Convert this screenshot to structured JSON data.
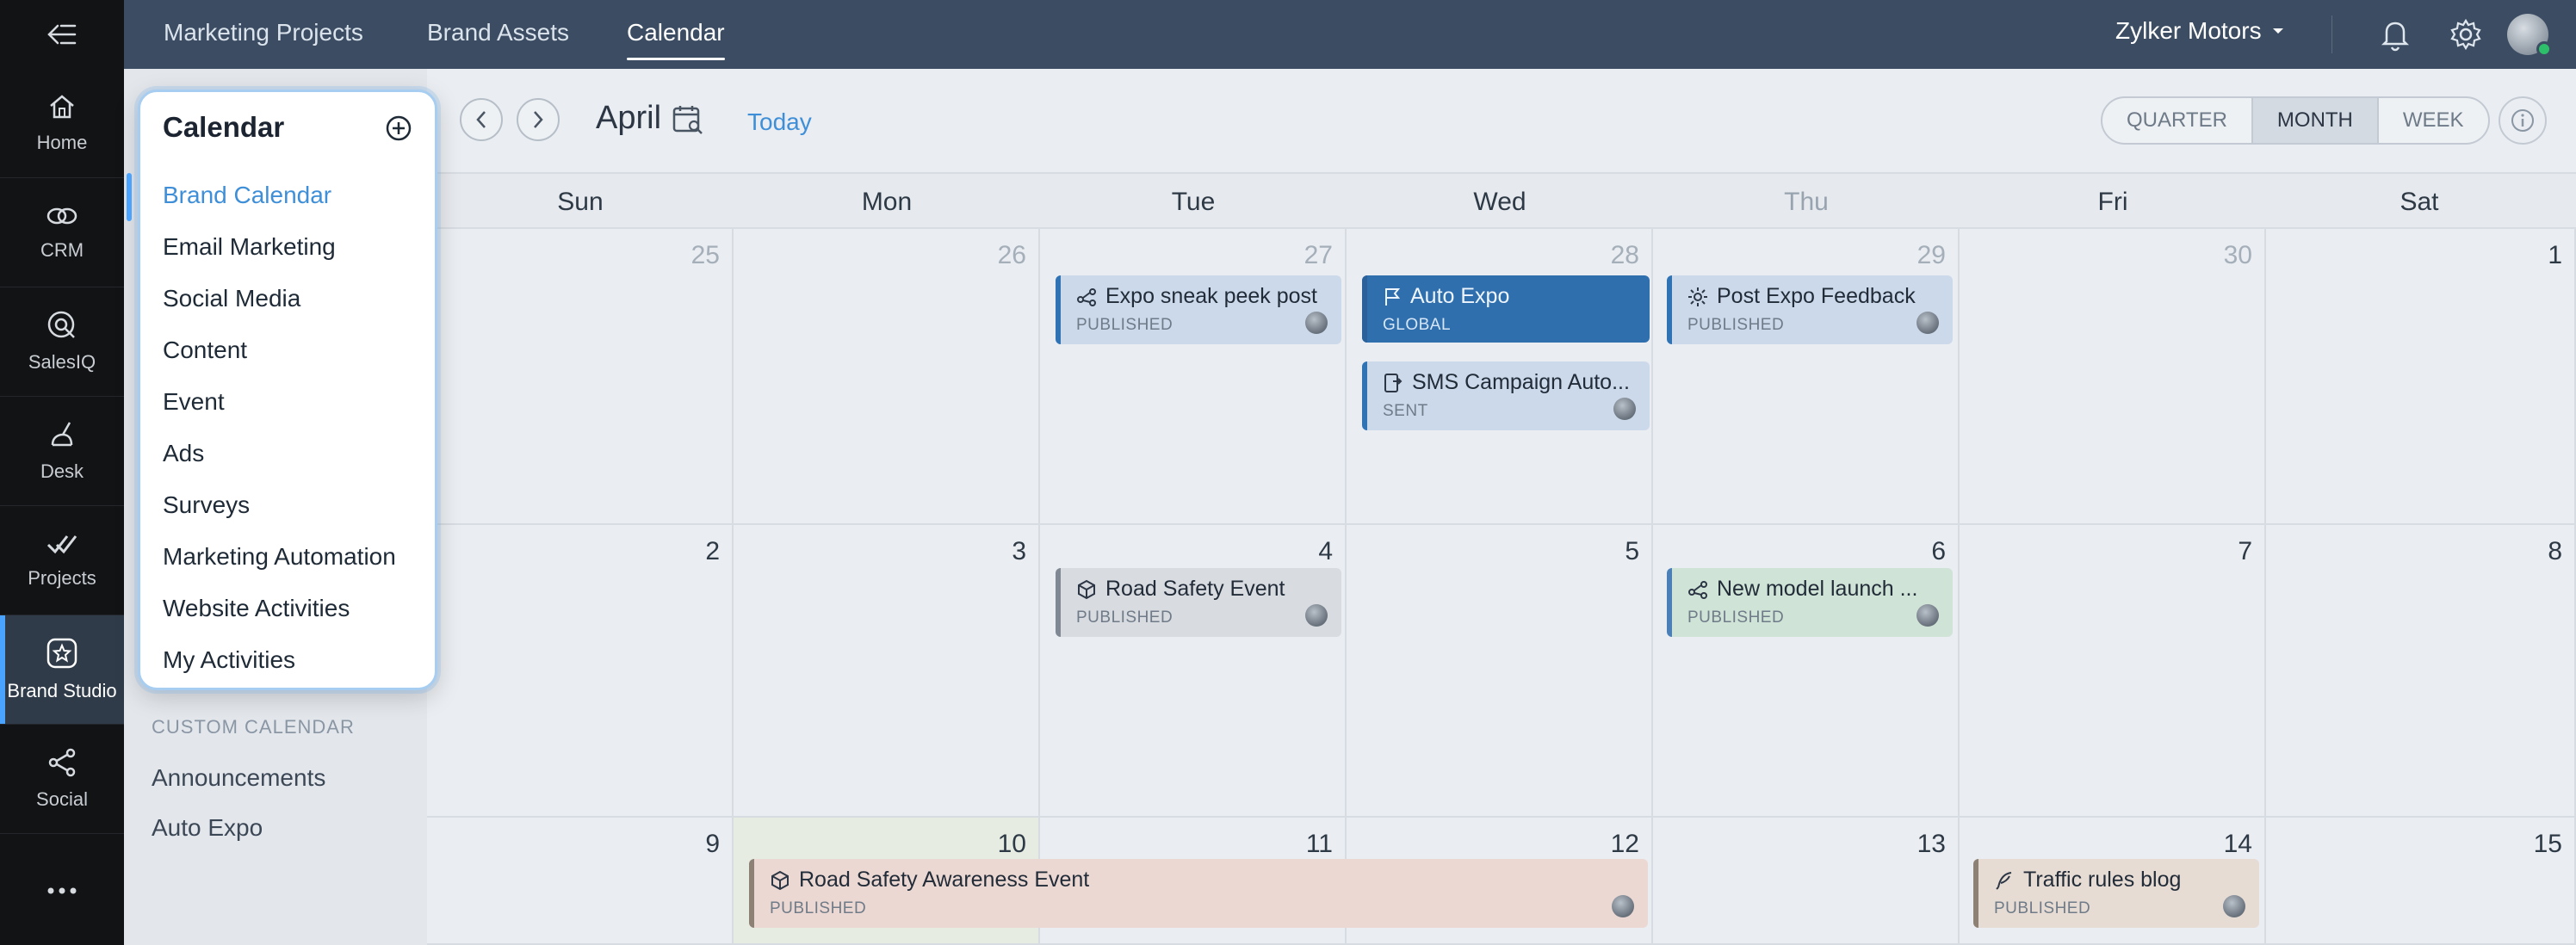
{
  "rail": {
    "items": [
      {
        "label": "Home",
        "icon": "home-icon"
      },
      {
        "label": "CRM",
        "icon": "crm-icon"
      },
      {
        "label": "SalesIQ",
        "icon": "salesiq-icon"
      },
      {
        "label": "Desk",
        "icon": "desk-icon"
      },
      {
        "label": "Projects",
        "icon": "projects-icon"
      },
      {
        "label": "Brand Studio",
        "icon": "brand-studio-icon"
      },
      {
        "label": "Social",
        "icon": "social-icon"
      }
    ],
    "active": "Brand Studio"
  },
  "topbar": {
    "tabs": [
      "Marketing Projects",
      "Brand Assets",
      "Calendar"
    ],
    "active_tab": "Calendar",
    "org_name": "Zylker Motors"
  },
  "toolbar": {
    "month": "April",
    "today": "Today",
    "views": [
      "QUARTER",
      "MONTH",
      "WEEK"
    ],
    "selected_view": "MONTH"
  },
  "popup": {
    "title": "Calendar",
    "items": [
      "Brand Calendar",
      "Email Marketing",
      "Social Media",
      "Content",
      "Event",
      "Ads",
      "Surveys",
      "Marketing Automation",
      "Website Activities",
      "My Activities"
    ],
    "active": "Brand Calendar"
  },
  "custom_calendar": {
    "heading": "CUSTOM CALENDAR",
    "items": [
      "Announcements",
      "Auto Expo"
    ]
  },
  "days_of_week": [
    "Sun",
    "Mon",
    "Tue",
    "Wed",
    "Thu",
    "Fri",
    "Sat"
  ],
  "weeks": [
    [
      "25",
      "26",
      "27",
      "28",
      "29",
      "30",
      "1"
    ],
    [
      "2",
      "3",
      "4",
      "5",
      "6",
      "7",
      "8"
    ],
    [
      "9",
      "10",
      "11",
      "12",
      "13",
      "14",
      "15"
    ]
  ],
  "events": [
    {
      "title": "Expo sneak peek post",
      "status": "PUBLISHED"
    },
    {
      "title": "Auto Expo",
      "status": "GLOBAL"
    },
    {
      "title": "SMS Campaign Auto...",
      "status": "SENT"
    },
    {
      "title": "Post Expo Feedback",
      "status": "PUBLISHED"
    },
    {
      "title": "Road Safety Event",
      "status": "PUBLISHED"
    },
    {
      "title": "New model launch ...",
      "status": "PUBLISHED"
    },
    {
      "title": "Road Safety Awareness Event",
      "status": "PUBLISHED"
    },
    {
      "title": "Traffic rules blog",
      "status": "PUBLISHED"
    }
  ],
  "colors": {
    "accent": "#4aa3ff",
    "topbar": "#3c4d63",
    "rail": "#111315",
    "today_link": "#3f8fd8",
    "global_event": "#2f6fae"
  }
}
